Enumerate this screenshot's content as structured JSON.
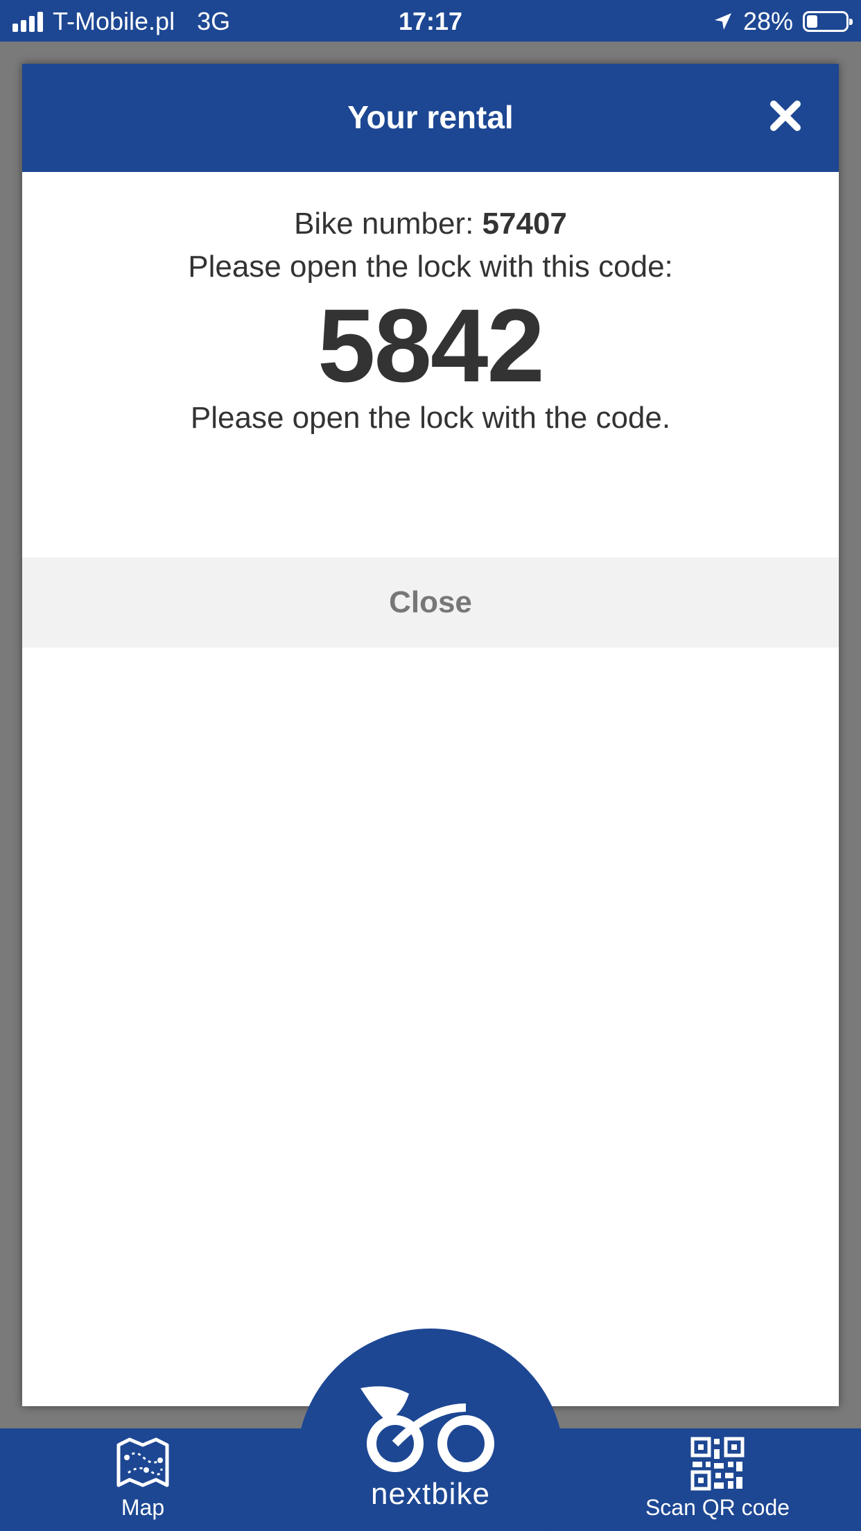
{
  "status_bar": {
    "carrier": "T-Mobile.pl",
    "network": "3G",
    "time": "17:17",
    "battery_percent": "28%",
    "battery_level": 0.28
  },
  "modal": {
    "title": "Your rental",
    "bike_number_label": "Bike number: ",
    "bike_number": "57407",
    "instruction": "Please open the lock with this code:",
    "lock_code": "5842",
    "note": "Please open the lock with the code.",
    "close_button_label": "Close"
  },
  "bottom_nav": {
    "map_label": "Map",
    "logo_text": "nextbike",
    "scan_label": "Scan QR code"
  },
  "colors": {
    "brand_blue": "#1d4793",
    "overlay_gray": "#7a7a7a",
    "text_dark": "#333333",
    "button_bg": "#f2f2f2",
    "button_text": "#777777"
  }
}
